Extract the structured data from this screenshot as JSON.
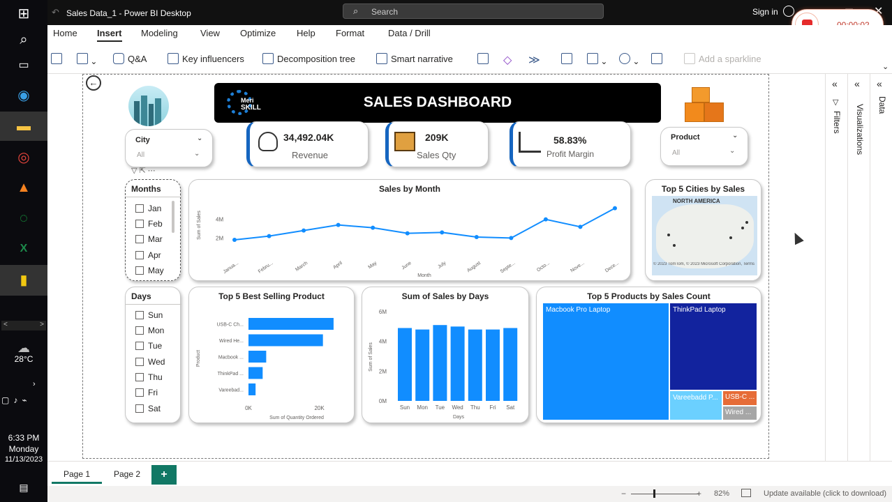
{
  "window": {
    "title": "Sales Data_1 - Power BI Desktop",
    "search_placeholder": "Search",
    "sign_in": "Sign in",
    "recording_time": "00:00:02"
  },
  "ribbon_tabs": [
    "Home",
    "Insert",
    "Modeling",
    "View",
    "Optimize",
    "Help",
    "Format",
    "Data / Drill"
  ],
  "active_tab": "Insert",
  "ribbon_buttons": {
    "qa": "Q&A",
    "key_influencers": "Key influencers",
    "decomposition_tree": "Decomposition tree",
    "smart_narrative": "Smart narrative",
    "add_sparkline": "Add a sparkline"
  },
  "dashboard": {
    "header": {
      "title": "SALES DASHBOARD",
      "logo_line1": "Meri",
      "logo_line2": "SKILL"
    },
    "city_slicer": {
      "title": "City",
      "value": "All"
    },
    "product_slicer": {
      "title": "Product",
      "value": "All"
    },
    "kpis": {
      "revenue_value": "34,492.04K",
      "revenue_label": "Revenue",
      "qty_value": "209K",
      "qty_label": "Sales Qty",
      "margin_value": "58.83%",
      "margin_label": "Profit Margin"
    },
    "months_slicer": {
      "title": "Months",
      "items": [
        "Jan",
        "Feb",
        "Mar",
        "Apr",
        "May"
      ]
    },
    "days_slicer": {
      "title": "Days",
      "items": [
        "Sun",
        "Mon",
        "Tue",
        "Wed",
        "Thu",
        "Fri",
        "Sat"
      ]
    },
    "map": {
      "title": "Top 5 Cities by Sales",
      "region_label": "NORTH AMERICA",
      "credit": "© 2023 TomTom, © 2023 Microsoft Corporation, Terms"
    },
    "treemap": {
      "title": "Top 5 Products by Sales Count",
      "labels": [
        "Macbook Pro Laptop",
        "ThinkPad Laptop",
        "Vareebadd P...",
        "USB-C ...",
        "Wired ..."
      ],
      "colors": [
        "#118DFF",
        "#12239E",
        "#6BD0FF",
        "#E66C37",
        "#A6A6A6"
      ]
    }
  },
  "chart_data": [
    {
      "type": "line",
      "title": "Sales by Month",
      "xlabel": "Month",
      "ylabel": "Sum of Sales",
      "x": [
        "Janua...",
        "Febru...",
        "March",
        "April",
        "May",
        "June",
        "July",
        "August",
        "Septe...",
        "Octo...",
        "Nove...",
        "Dece..."
      ],
      "y_tick_labels": [
        "2M",
        "4M"
      ],
      "series": [
        {
          "values": [
            1.8,
            2.2,
            2.8,
            3.4,
            3.1,
            2.5,
            2.6,
            2.1,
            2.0,
            4.0,
            3.2,
            5.2
          ]
        }
      ],
      "ylim": [
        0,
        6
      ],
      "color": "#118DFF"
    },
    {
      "type": "bar",
      "orientation": "horizontal",
      "title": "Top 5 Best Selling Product",
      "xlabel": "Sum of Quantity Ordered",
      "ylabel": "Product",
      "categories": [
        "USB-C Ch...",
        "Wired He...",
        "Macbook ...",
        "ThinkPad ...",
        "Vareebad..."
      ],
      "values": [
        24000,
        21000,
        5000,
        4000,
        2000
      ],
      "x_tick_labels": [
        "0K",
        "20K"
      ],
      "xlim": [
        0,
        25000
      ],
      "color": "#118DFF"
    },
    {
      "type": "bar",
      "title": "Sum of Sales by Days",
      "xlabel": "Days",
      "ylabel": "Sum of Sales",
      "categories": [
        "Sun",
        "Mon",
        "Tue",
        "Wed",
        "Thu",
        "Fri",
        "Sat"
      ],
      "values": [
        4.9,
        4.8,
        5.1,
        5.0,
        4.8,
        4.8,
        4.9
      ],
      "y_tick_labels": [
        "0M",
        "2M",
        "4M",
        "6M"
      ],
      "ylim": [
        0,
        6
      ],
      "color": "#118DFF"
    }
  ],
  "right_panels": {
    "filters": "Filters",
    "visualizations": "Visualizations",
    "data": "Data"
  },
  "pages": {
    "page1": "Page 1",
    "page2": "Page 2",
    "add": "+"
  },
  "status": {
    "zoom": "82%",
    "update": "Update available (click to download)"
  },
  "system": {
    "temp": "28°C",
    "time": "6:33 PM",
    "day": "Monday",
    "date": "11/13/2023"
  }
}
